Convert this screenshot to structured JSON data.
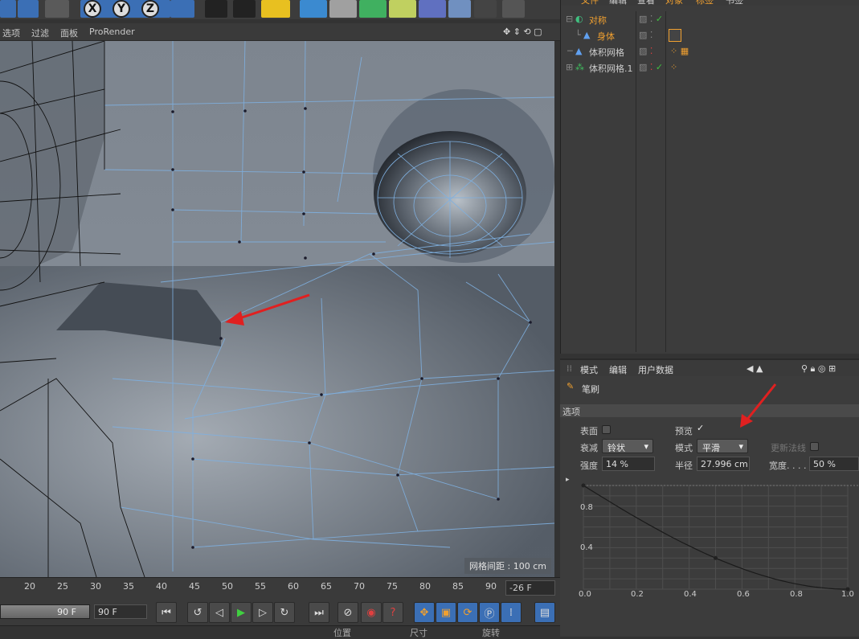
{
  "viewport_menu": [
    "选项",
    "过滤",
    "面板",
    "ProRender"
  ],
  "viewport": {
    "grid_label": "网格间距 : 100 cm"
  },
  "axes": [
    "X",
    "Y",
    "Z"
  ],
  "timeline": {
    "ticks": [
      "20",
      "25",
      "30",
      "35",
      "40",
      "45",
      "50",
      "55",
      "60",
      "65",
      "70",
      "75",
      "80",
      "85",
      "90"
    ],
    "current_frame": "-26 F"
  },
  "transport": {
    "end_frame_slider": "90 F",
    "end_frame": "90 F"
  },
  "bottom_strip": [
    "位置",
    "尺寸",
    "旋转"
  ],
  "object_manager": {
    "menu": [
      "文件",
      "编辑",
      "查看",
      "对象",
      "标签",
      "书签"
    ],
    "objects": [
      {
        "name": "对称",
        "color": "#f0a030"
      },
      {
        "name": "身体",
        "color": "#f0a030"
      },
      {
        "name": "体积网格",
        "color": "#cccccc"
      },
      {
        "name": "体积网格.1",
        "color": "#cccccc"
      }
    ]
  },
  "attribute_manager": {
    "menu": [
      "模式",
      "编辑",
      "用户数据"
    ],
    "tool_name": "笔刷",
    "section": "选项",
    "surface_label": "表面",
    "preview_label": "预览",
    "falloff_label": "衰减",
    "falloff_value": "铃状",
    "mode_label": "模式",
    "mode_value": "平滑",
    "update_normals_label": "更新法线",
    "strength_label": "强度",
    "strength_value": "14 %",
    "radius_label": "半径",
    "radius_value": "27.996 cm",
    "width_label": "宽度. . . .",
    "width_value": "50 %",
    "graph": {
      "y_ticks": [
        "0.8",
        "0.4"
      ],
      "x_ticks": [
        "0.0",
        "0.2",
        "0.4",
        "0.6",
        "0.8",
        "1.0"
      ]
    }
  },
  "chart_data": {
    "type": "line",
    "title": "",
    "xlabel": "",
    "ylabel": "",
    "xlim": [
      0,
      1
    ],
    "ylim": [
      0,
      1
    ],
    "x": [
      0.0,
      0.5,
      1.0
    ],
    "y": [
      1.0,
      0.3,
      0.0
    ]
  },
  "colors": {
    "accent_orange": "#f0a030",
    "arrow_red": "#e02020",
    "wire_blue": "#7fb0e0"
  }
}
